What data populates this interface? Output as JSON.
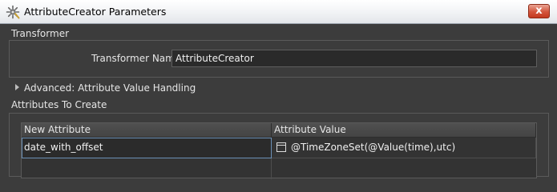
{
  "window": {
    "title": "AttributeCreator Parameters",
    "close_label": "x"
  },
  "transformer": {
    "section_label": "Transformer",
    "name_label": "Transformer Name:",
    "name_value": "AttributeCreator"
  },
  "advanced": {
    "label": "Advanced: Attribute Value Handling"
  },
  "attributes": {
    "section_label": "Attributes To Create",
    "columns": [
      "New Attribute",
      "Attribute Value"
    ],
    "rows": [
      {
        "name": "date_with_offset",
        "value": "@TimeZoneSet(@Value(time),utc)"
      }
    ]
  }
}
